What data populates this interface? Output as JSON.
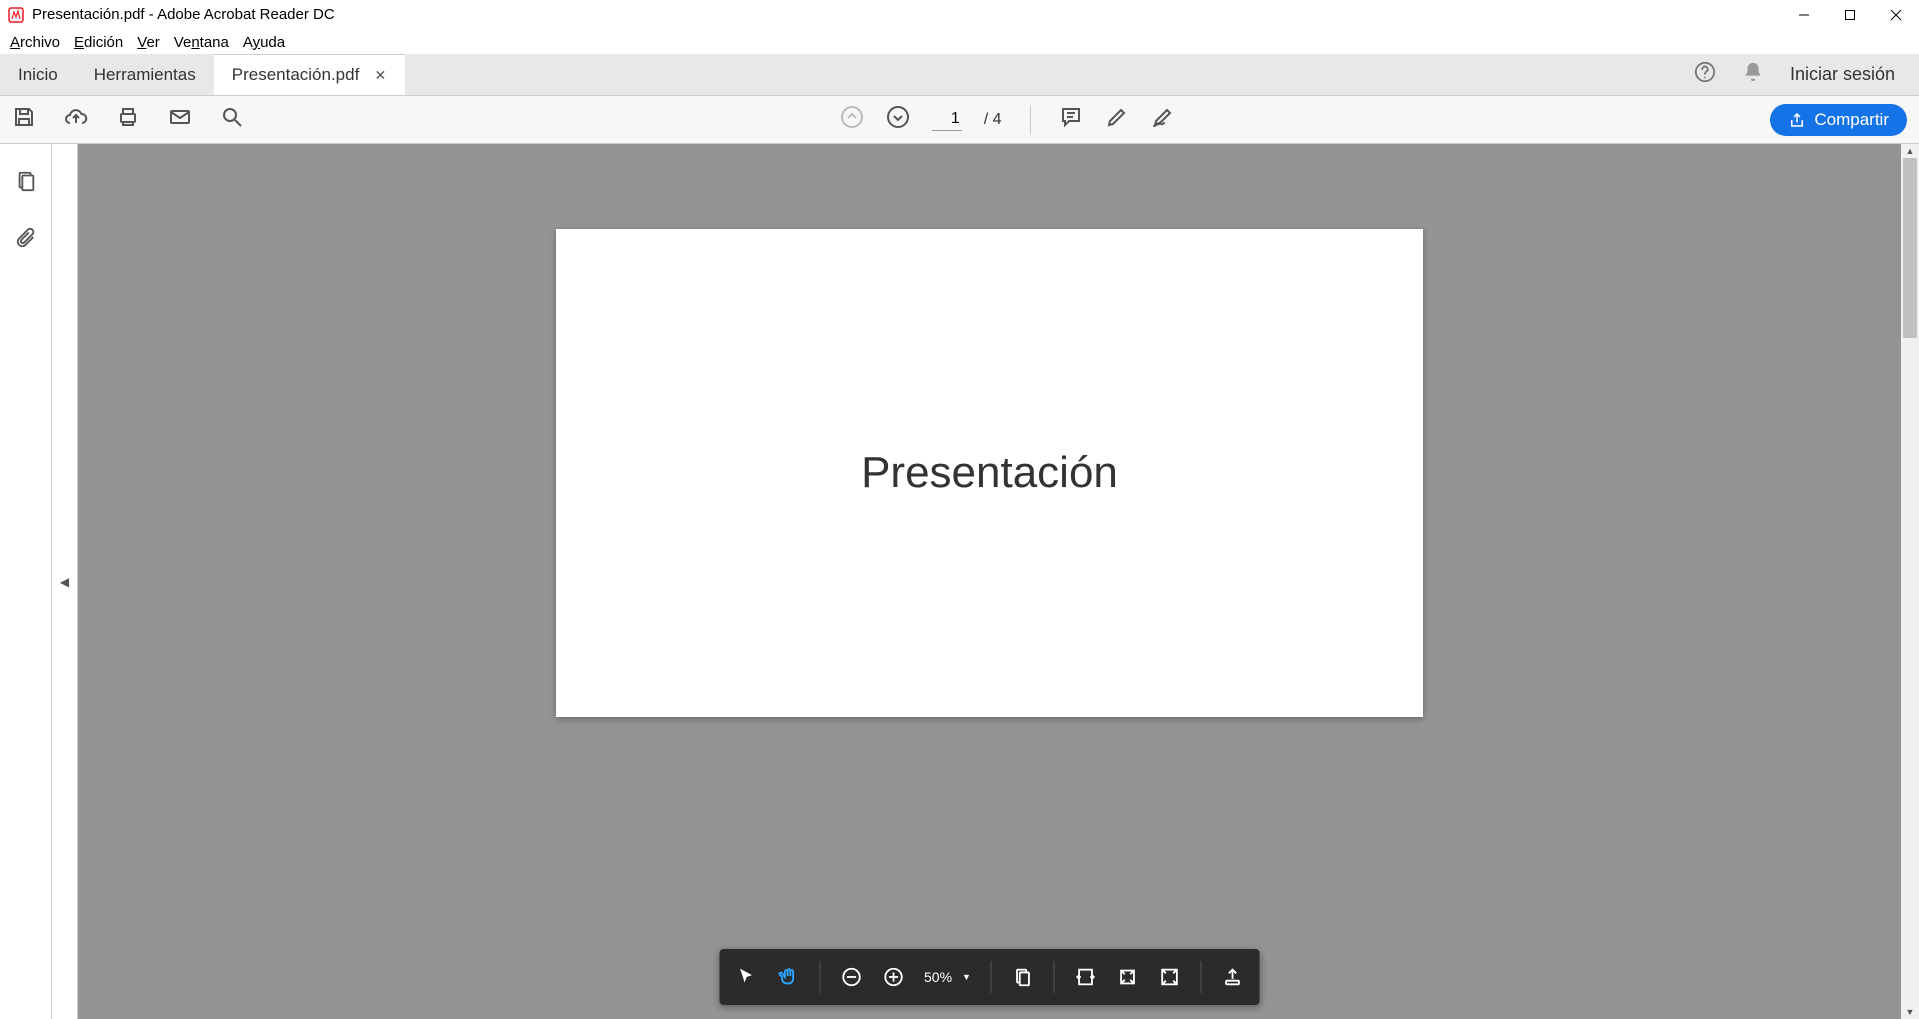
{
  "titlebar": {
    "title": "Presentación.pdf - Adobe Acrobat Reader DC"
  },
  "menubar": {
    "archivo": "Archivo",
    "edicion": "Edición",
    "ver": "Ver",
    "ventana": "Ventana",
    "ayuda": "Ayuda"
  },
  "tabs": {
    "inicio": "Inicio",
    "herramientas": "Herramientas",
    "doc": "Presentación.pdf"
  },
  "topright": {
    "signin": "Iniciar sesión"
  },
  "toolbar": {
    "page_current": "1",
    "page_total": "/ 4",
    "share_label": "Compartir"
  },
  "float": {
    "zoom": "50%"
  },
  "document": {
    "page1_text": "Presentación"
  }
}
